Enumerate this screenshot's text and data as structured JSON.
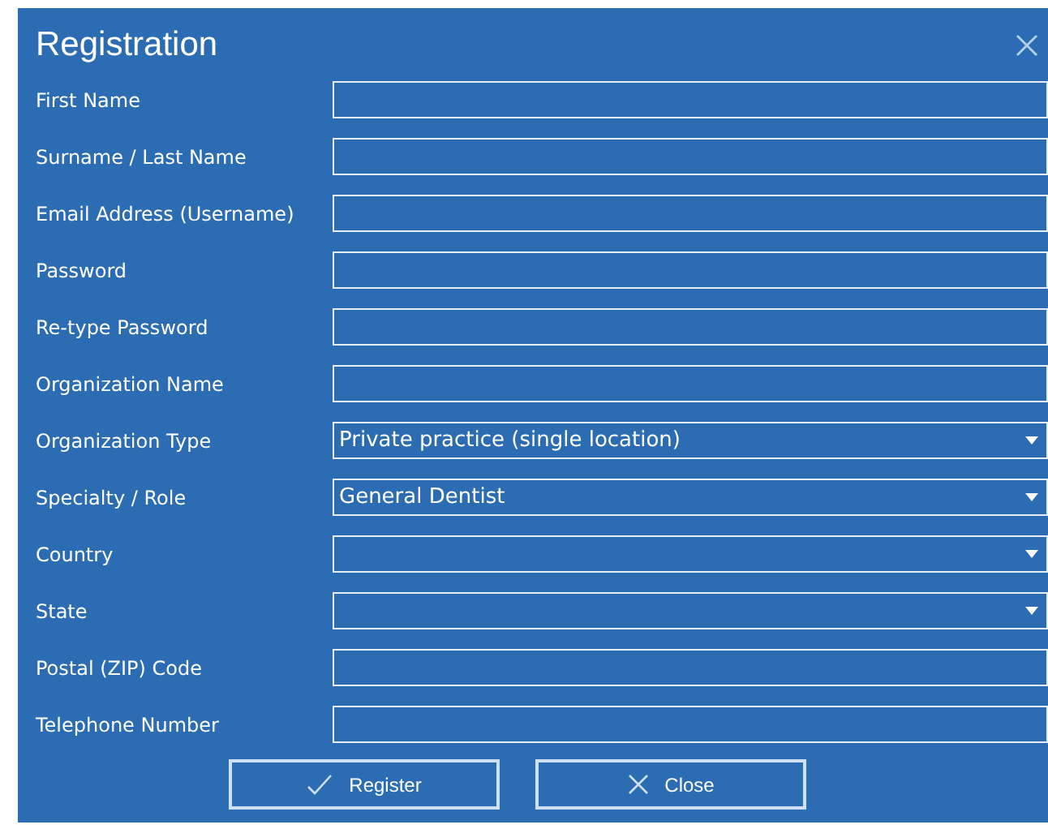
{
  "window": {
    "title": "Registration"
  },
  "fields": [
    {
      "label": "First Name",
      "kind": "text"
    },
    {
      "label": "Surname / Last Name",
      "kind": "text"
    },
    {
      "label": "Email Address (Username)",
      "kind": "text"
    },
    {
      "label": "Password",
      "kind": "text"
    },
    {
      "label": "Re-type Password",
      "kind": "text"
    },
    {
      "label": "Organization Name",
      "kind": "text"
    },
    {
      "label": "Organization Type",
      "kind": "select",
      "value": "Private practice (single location)"
    },
    {
      "label": "Specialty / Role",
      "kind": "select",
      "value": "General Dentist"
    },
    {
      "label": "Country",
      "kind": "select"
    },
    {
      "label": "State",
      "kind": "select"
    },
    {
      "label": "Postal (ZIP) Code",
      "kind": "text"
    },
    {
      "label": "Telephone Number",
      "kind": "text"
    }
  ],
  "buttons": [
    {
      "label": "Register",
      "kind": "confirm"
    },
    {
      "label": "Close",
      "kind": "close"
    }
  ]
}
